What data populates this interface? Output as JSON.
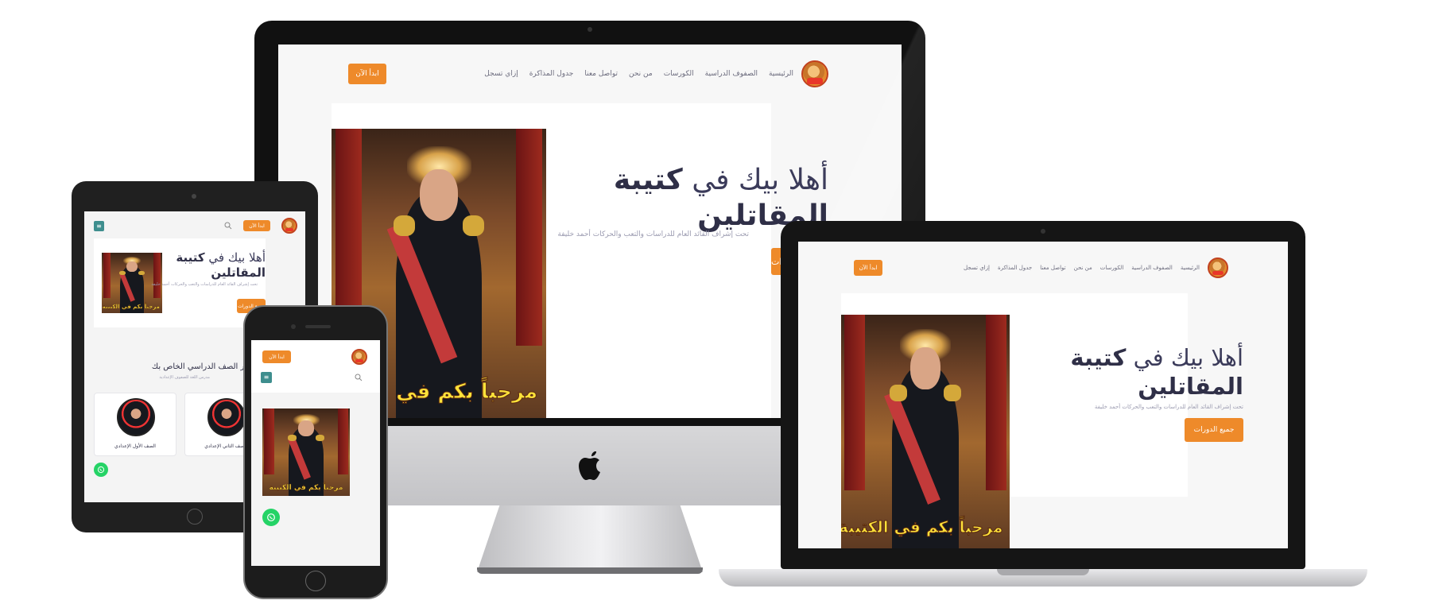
{
  "site": {
    "nav": {
      "links": [
        "الرئيسية",
        "الصفوف الدراسية",
        "الكورسات",
        "من نحن",
        "تواصل معنا",
        "جدول المذاكرة",
        "إزاي تسجل"
      ],
      "cta": "ابدأ الآن"
    },
    "hero": {
      "headline_light": "أهلا بيك في",
      "headline_bold_1": "كتيبة",
      "headline_bold_2": "المقاتلين",
      "subline": "تحت إشراف القائد العام للدراسات والتعب والحركات أحمد خليفة",
      "cta": "جميع الدورات",
      "image_banner": "مرحباً بكم في الكتيبة"
    },
    "grades": {
      "title": "اختر الصف الدراسي الخاص بك",
      "subtitle": "مدرس اللغة للصفوف الإعدادية",
      "items": [
        "الصف الأول الإعدادي",
        "الصف الثاني الإعدادي"
      ]
    }
  },
  "colors": {
    "accent": "#ee8a2a",
    "heading": "#2f2f47",
    "menu_button": "#3e8e8e",
    "whatsapp": "#25d366"
  },
  "icons": [
    "logo-icon",
    "search-icon",
    "menu-icon",
    "whatsapp-icon",
    "apple-logo-icon"
  ]
}
